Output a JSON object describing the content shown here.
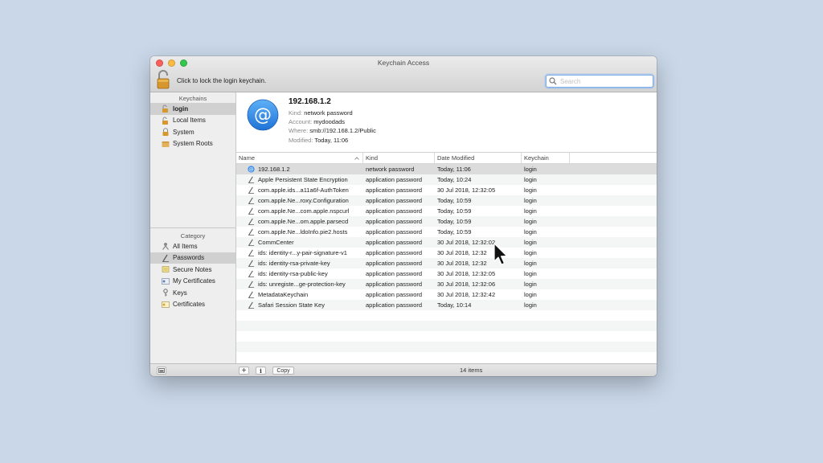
{
  "window": {
    "title": "Keychain Access"
  },
  "toolbar": {
    "lock_text": "Click to lock the login keychain.",
    "search_placeholder": "Search"
  },
  "sidebar": {
    "keychains_header": "Keychains",
    "keychains": [
      {
        "label": "login",
        "icon": "open-lock-icon"
      },
      {
        "label": "Local Items",
        "icon": "open-lock-icon"
      },
      {
        "label": "System",
        "icon": "lock-icon"
      },
      {
        "label": "System Roots",
        "icon": "folder-icon"
      }
    ],
    "category_header": "Category",
    "categories": [
      {
        "label": "All Items",
        "icon": "people-icon"
      },
      {
        "label": "Passwords",
        "icon": "pen-key-icon"
      },
      {
        "label": "Secure Notes",
        "icon": "note-icon"
      },
      {
        "label": "My Certificates",
        "icon": "certificate-icon"
      },
      {
        "label": "Keys",
        "icon": "key-icon"
      },
      {
        "label": "Certificates",
        "icon": "certificate-icon"
      }
    ]
  },
  "detail": {
    "name": "192.168.1.2",
    "kind_label": "Kind:",
    "kind_value": "network password",
    "account_label": "Account:",
    "account_value": "mydoodads",
    "where_label": "Where:",
    "where_value": "smb://192.168.1.2/Public",
    "modified_label": "Modified:",
    "modified_value": "Today, 11:06"
  },
  "table": {
    "columns": [
      "Name",
      "Kind",
      "Date Modified",
      "Keychain"
    ],
    "rows": [
      {
        "name": "192.168.1.2",
        "kind": "network password",
        "date": "Today, 11:06",
        "keychain": "login"
      },
      {
        "name": "Apple Persistent State Encryption",
        "kind": "application password",
        "date": "Today, 10:24",
        "keychain": "login"
      },
      {
        "name": "com.apple.ids...a11a6f-AuthToken",
        "kind": "application password",
        "date": "30 Jul 2018, 12:32:05",
        "keychain": "login"
      },
      {
        "name": "com.apple.Ne...roxy.Configuration",
        "kind": "application password",
        "date": "Today, 10:59",
        "keychain": "login"
      },
      {
        "name": "com.apple.Ne...com.apple.nspcurl",
        "kind": "application password",
        "date": "Today, 10:59",
        "keychain": "login"
      },
      {
        "name": "com.apple.Ne...om.apple.parsecd",
        "kind": "application password",
        "date": "Today, 10:59",
        "keychain": "login"
      },
      {
        "name": "com.apple.Ne...ldoInfo.pie2.hosts",
        "kind": "application password",
        "date": "Today, 10:59",
        "keychain": "login"
      },
      {
        "name": "CommCenter",
        "kind": "application password",
        "date": "30 Jul 2018, 12:32:02",
        "keychain": "login"
      },
      {
        "name": "ids: identity-r...y-pair-signature-v1",
        "kind": "application password",
        "date": "30 Jul 2018, 12:32",
        "keychain": "login"
      },
      {
        "name": "ids: identity-rsa-private-key",
        "kind": "application password",
        "date": "30 Jul 2018, 12:32",
        "keychain": "login"
      },
      {
        "name": "ids: identity-rsa-public-key",
        "kind": "application password",
        "date": "30 Jul 2018, 12:32:05",
        "keychain": "login"
      },
      {
        "name": "ids: unregiste...ge-protection-key",
        "kind": "application password",
        "date": "30 Jul 2018, 12:32:06",
        "keychain": "login"
      },
      {
        "name": "MetadataKeychain",
        "kind": "application password",
        "date": "30 Jul 2018, 12:32:42",
        "keychain": "login"
      },
      {
        "name": "Safari Session State Key",
        "kind": "application password",
        "date": "Today, 10:14",
        "keychain": "login"
      }
    ]
  },
  "footer": {
    "copy_label": "Copy",
    "item_count": "14 items"
  },
  "colors": {
    "accent": "#3b8de8",
    "selection": "#dcdcdc"
  }
}
